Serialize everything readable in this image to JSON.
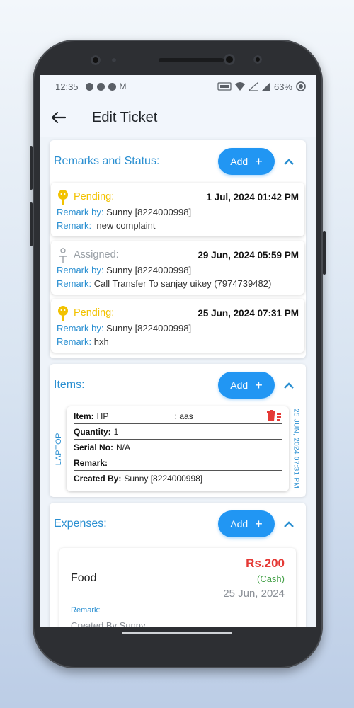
{
  "status_bar": {
    "time": "12:35",
    "battery": "63%"
  },
  "app_bar": {
    "title": "Edit Ticket"
  },
  "remarks_section": {
    "title": "Remarks and Status:",
    "add_label": "Add",
    "items": [
      {
        "status": "Pending:",
        "status_color": "#f2c200",
        "date": "1 Jul, 2024 01:42 PM",
        "by_label": "Remark by:",
        "by_value": "Sunny [8224000998]",
        "remark_label": "Remark:",
        "remark_value": "new complaint"
      },
      {
        "status": "Assigned:",
        "status_color": "#9aa0a6",
        "date": "29 Jun, 2024 05:59 PM",
        "by_label": "Remark by:",
        "by_value": "Sunny [8224000998]",
        "remark_label": "Remark:",
        "remark_value": "Call Transfer To sanjay uikey (7974739482)"
      },
      {
        "status": "Pending:",
        "status_color": "#f2c200",
        "date": "25 Jun, 2024 07:31 PM",
        "by_label": "Remark by:",
        "by_value": "Sunny [8224000998]",
        "remark_label": "Remark:",
        "remark_value": "hxh"
      }
    ]
  },
  "items_section": {
    "title": "Items:",
    "add_label": "Add",
    "item": {
      "category": "LAPTOP",
      "date": "25 JUN, 2024 07:31 PM",
      "item_label": "Item:",
      "item_value": "HP",
      "item_extra": ": aas",
      "quantity_label": "Quantity:",
      "quantity_value": "1",
      "serial_label": "Serial No:",
      "serial_value": "N/A",
      "remark_label": "Remark:",
      "remark_value": "",
      "created_label": "Created By:",
      "created_value": "Sunny [8224000998]"
    }
  },
  "expenses_section": {
    "title": "Expenses:",
    "add_label": "Add",
    "expense": {
      "name": "Food",
      "amount": "Rs.200",
      "mode": "(Cash)",
      "date": "25 Jun, 2024",
      "remark_label": "Remark:",
      "created": "Created By Sunny"
    }
  }
}
